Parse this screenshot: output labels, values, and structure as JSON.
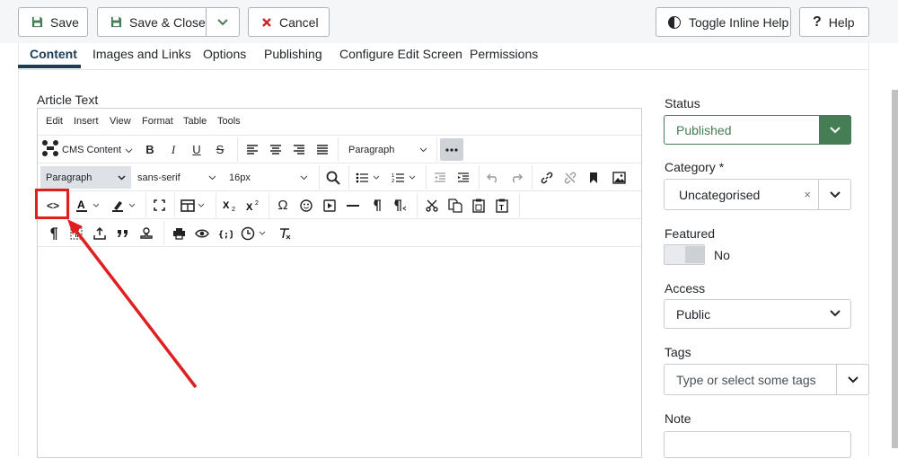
{
  "toolbar": {
    "save_label": "Save",
    "save_close_label": "Save & Close",
    "cancel_label": "Cancel",
    "toggle_help_label": "Toggle Inline Help",
    "help_label": "Help"
  },
  "tabs": [
    {
      "label": "Content",
      "active": true
    },
    {
      "label": "Images and Links"
    },
    {
      "label": "Options"
    },
    {
      "label": "Publishing"
    },
    {
      "label": "Configure Edit Screen"
    },
    {
      "label": "Permissions"
    }
  ],
  "editor": {
    "label": "Article Text",
    "menu": [
      "Edit",
      "Insert",
      "View",
      "Format",
      "Table",
      "Tools"
    ],
    "cms_content_label": "CMS Content",
    "block_format_1": "Paragraph",
    "block_format_2": "Paragraph",
    "font_family": "sans-serif",
    "font_size": "16px",
    "bold": "B",
    "italic": "I",
    "underline": "U",
    "strike": "S",
    "source_code": "<>",
    "omega": "Ω"
  },
  "sidebar": {
    "status_label": "Status",
    "status_value": "Published",
    "category_label": "Category *",
    "category_value": "Uncategorised",
    "category_clear": "×",
    "featured_label": "Featured",
    "featured_value": "No",
    "access_label": "Access",
    "access_value": "Public",
    "tags_label": "Tags",
    "tags_placeholder": "Type or select some tags",
    "note_label": "Note"
  },
  "colors": {
    "accent_green": "#457d54",
    "cancel_red": "#c52827",
    "highlight_red": "#e02020",
    "tab_active": "#1f3c57"
  }
}
